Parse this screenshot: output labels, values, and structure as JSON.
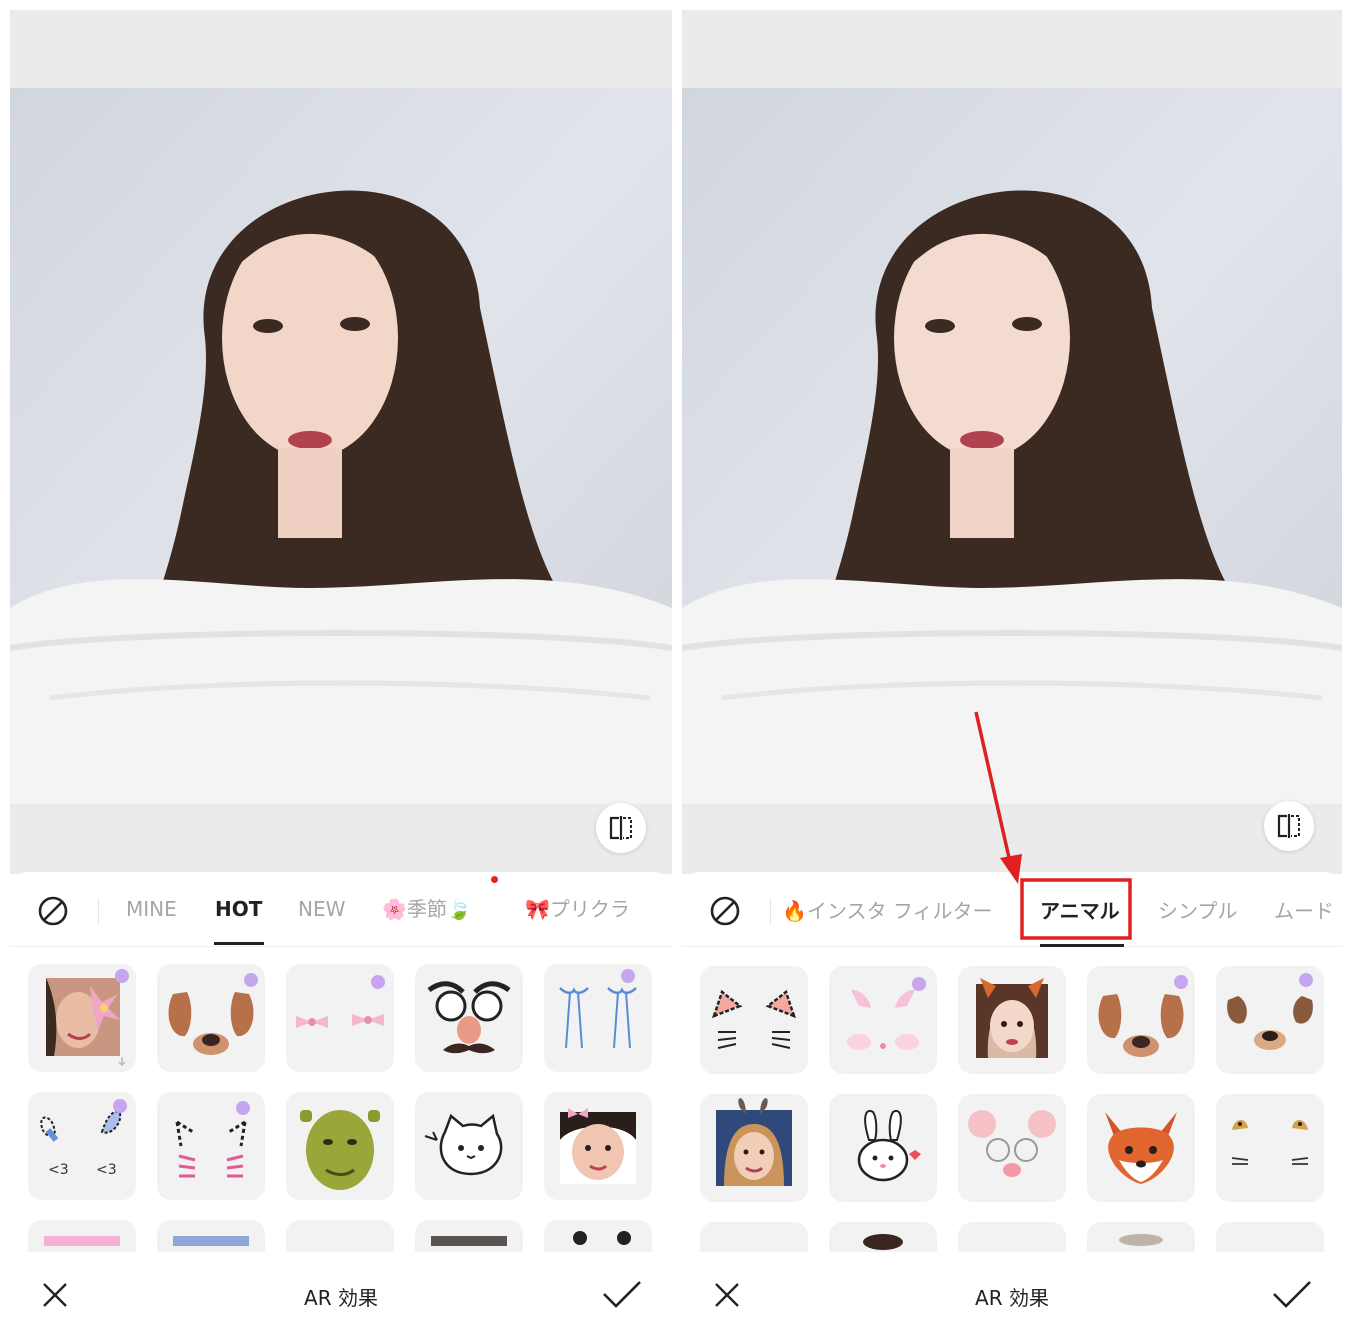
{
  "left": {
    "tabs": [
      {
        "label": "MINE",
        "active": false
      },
      {
        "label": "HOT",
        "active": true
      },
      {
        "label": "NEW",
        "active": false
      },
      {
        "label": "🌸季節🍃",
        "active": false
      },
      {
        "label": "🎀プリクラ",
        "active": false
      }
    ],
    "effects_row1": [
      "lily-flower-effect",
      "dog-ears-effect",
      "pink-bows-effect",
      "groucho-glasses-effect",
      "blue-ribbons-effect"
    ],
    "effects_row2": [
      "bunny-doodle-effect",
      "leopard-cat-doodle-effect",
      "shrek-effect",
      "cat-doodle-effect",
      "baby-face-effect"
    ],
    "toolbar_title": "AR 効果"
  },
  "right": {
    "tabs": [
      {
        "label": "🔥インスタ フィルター",
        "active": false
      },
      {
        "label": "アニマル",
        "active": true
      },
      {
        "label": "シンプル",
        "active": false
      },
      {
        "label": "ムード",
        "active": false
      }
    ],
    "effects_row1": [
      "cat-ears-doodle-effect",
      "pink-bunny-blush-effect",
      "fox-girl-effect",
      "dog-ears-effect",
      "puppy-effect"
    ],
    "effects_row2": [
      "bunny-ears-portrait-effect",
      "bunny-sticker-effect",
      "mouse-glasses-effect",
      "fox-face-effect",
      "leopard-ears-effect"
    ],
    "toolbar_title": "AR 効果"
  },
  "colors": {
    "highlight": "#e02020",
    "accent": "#222222",
    "inactive": "#a6a6a6"
  }
}
